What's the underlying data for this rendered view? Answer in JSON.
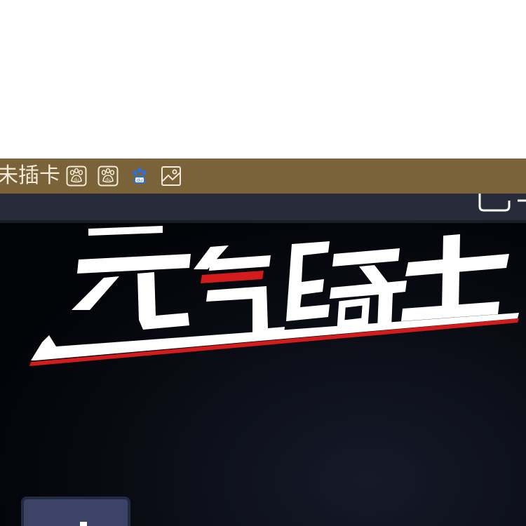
{
  "bookmark_bar": {
    "partial_label": "未插卡",
    "icons": [
      "baidu-paw-icon",
      "baidu-paw-icon",
      "baidu-paw-color-icon",
      "image-icon"
    ]
  },
  "colors": {
    "bookmark_bg": "#7a6338",
    "bookmark_text": "#f3ead9",
    "nav_bg": "#272b3a",
    "game_bg": "#020307",
    "logo_white": "#ffffff",
    "logo_red": "#d41c1c",
    "button_bg": "#3b4467"
  },
  "game": {
    "logo_label": "元气骑士"
  }
}
